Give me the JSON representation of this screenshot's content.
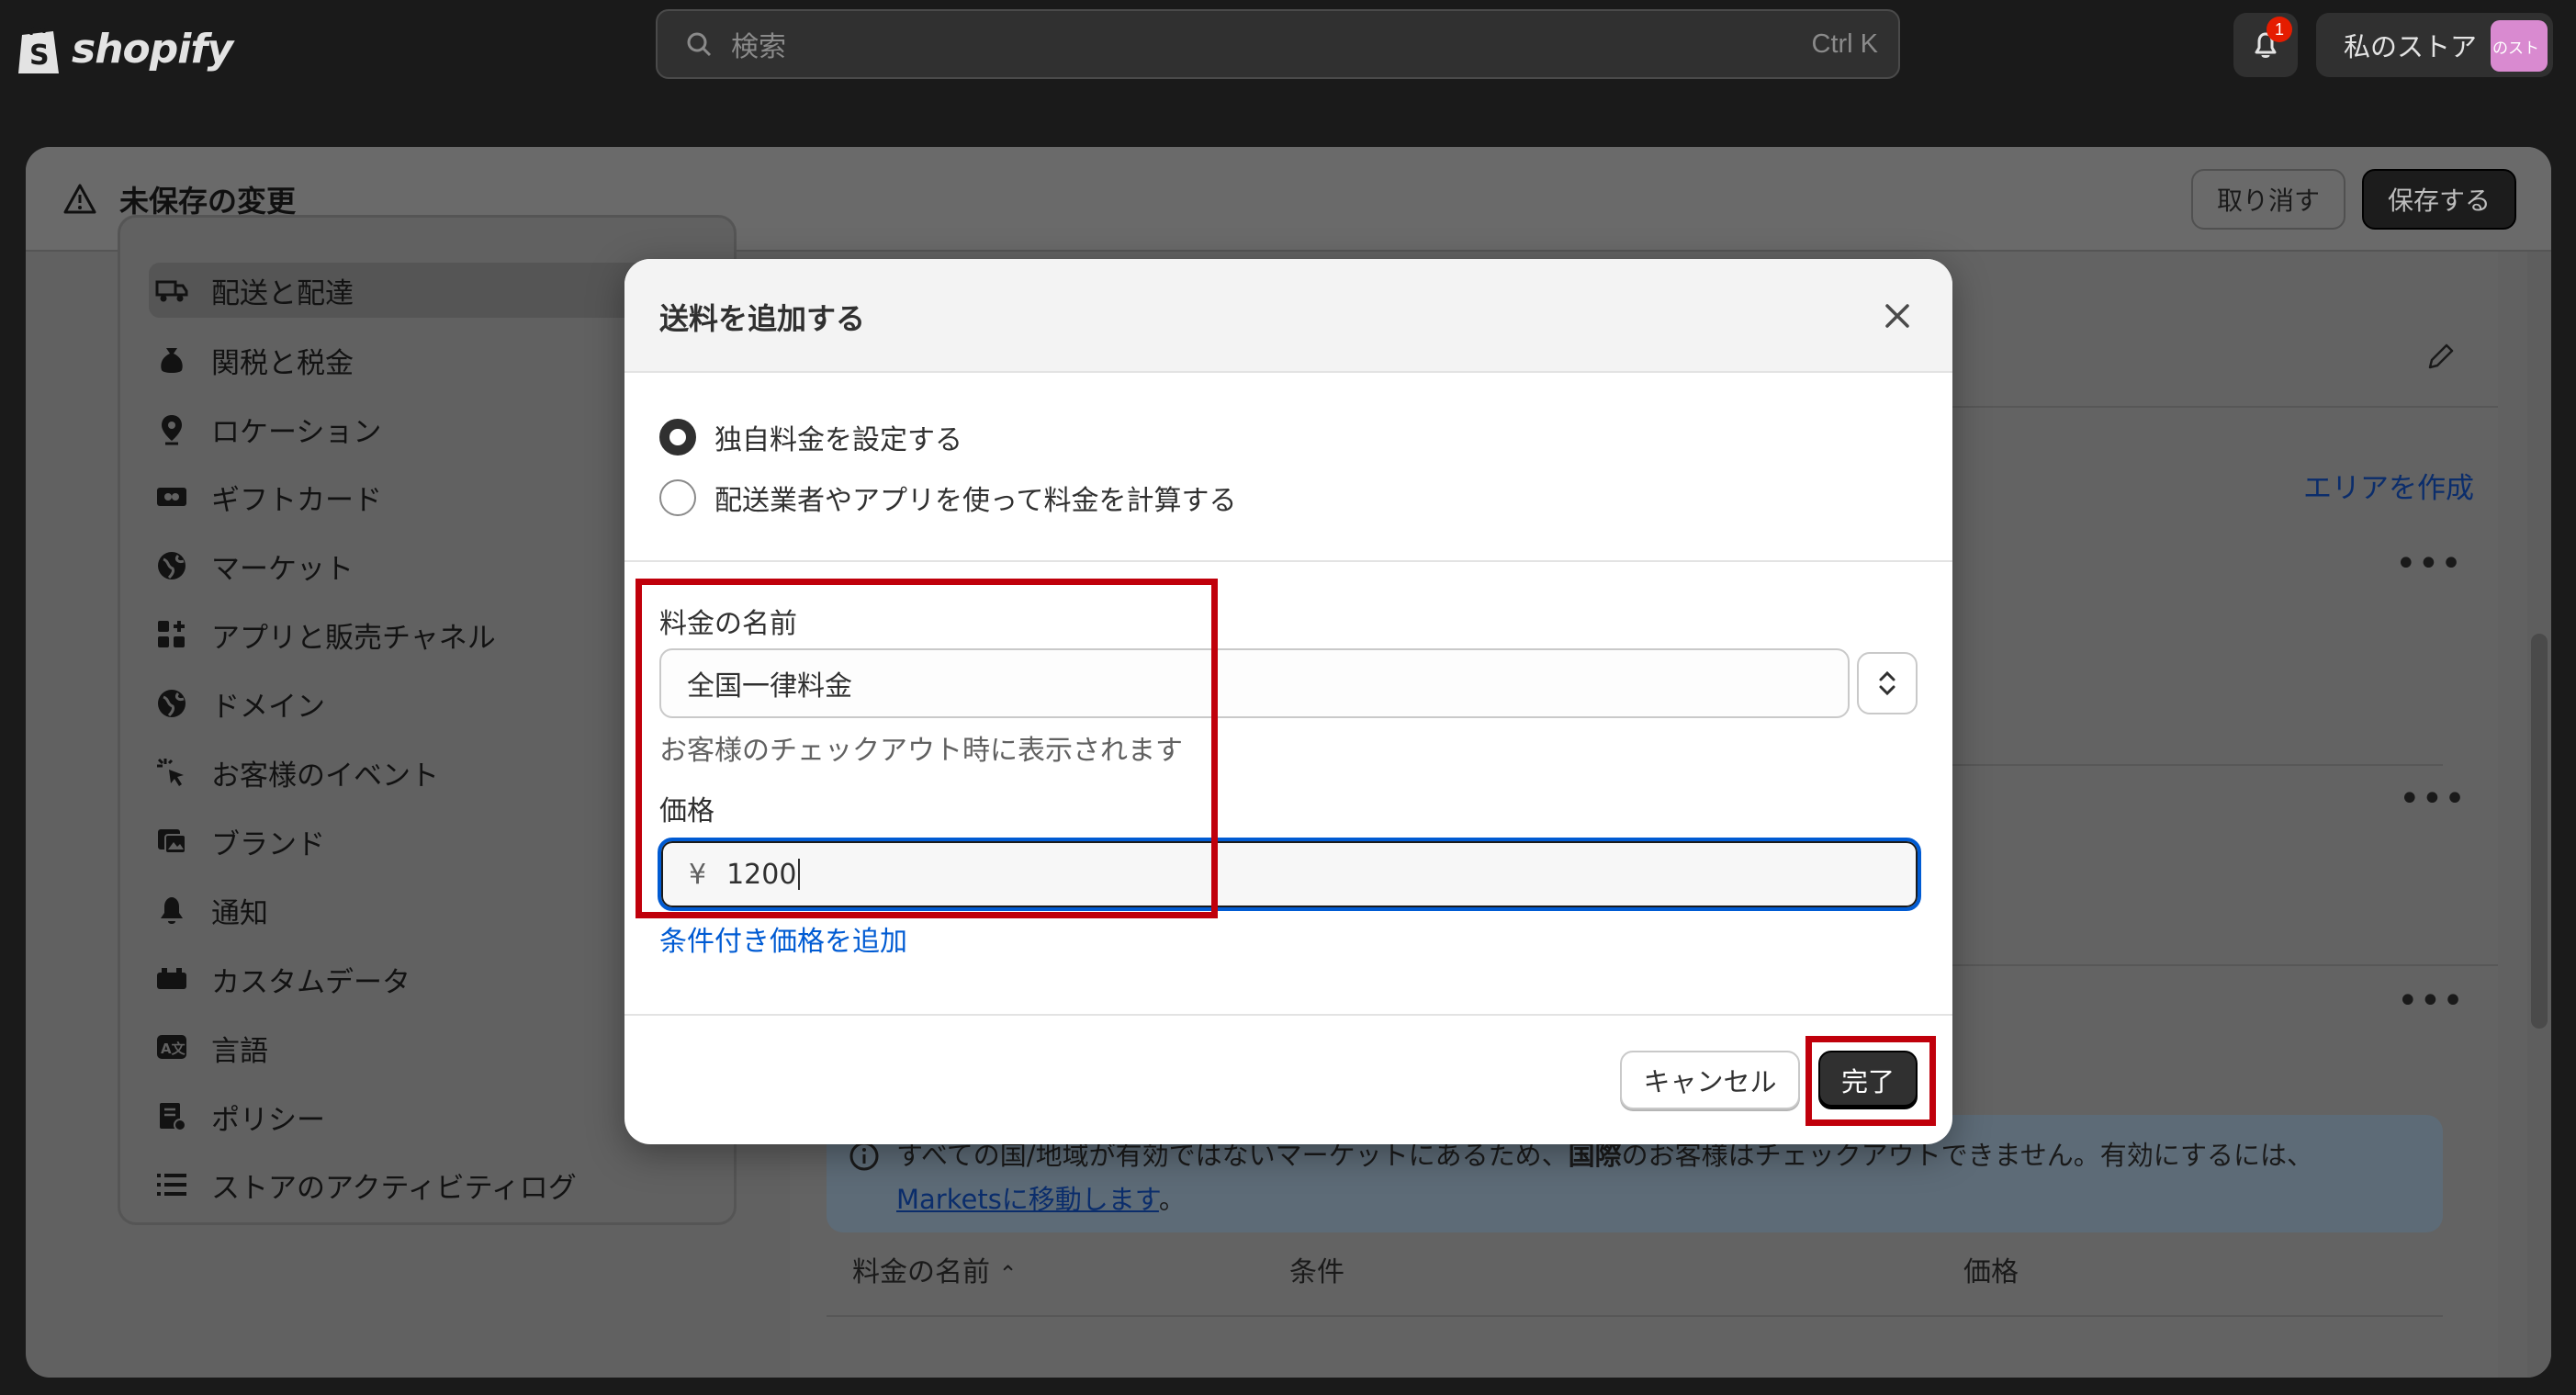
{
  "topbar": {
    "logo_text": "shopify",
    "search_placeholder": "検索",
    "search_shortcut": "Ctrl K",
    "notification_count": "1",
    "store_name": "私のストア",
    "store_avatar": "のスト"
  },
  "unsaved": {
    "title": "未保存の変更",
    "discard_label": "取り消す",
    "save_label": "保存する"
  },
  "sidebar": {
    "items": [
      {
        "label": "配送と配達",
        "icon": "truck-icon"
      },
      {
        "label": "関税と税金",
        "icon": "money-bag-icon"
      },
      {
        "label": "ロケーション",
        "icon": "location-pin-icon"
      },
      {
        "label": "ギフトカード",
        "icon": "gift-card-icon"
      },
      {
        "label": "マーケット",
        "icon": "globe-icon"
      },
      {
        "label": "アプリと販売チャネル",
        "icon": "apps-icon"
      },
      {
        "label": "ドメイン",
        "icon": "domain-globe-icon"
      },
      {
        "label": "お客様のイベント",
        "icon": "cursor-click-icon"
      },
      {
        "label": "ブランド",
        "icon": "brand-image-icon"
      },
      {
        "label": "通知",
        "icon": "bell-icon"
      },
      {
        "label": "カスタムデータ",
        "icon": "database-icon"
      },
      {
        "label": "言語",
        "icon": "translate-icon"
      },
      {
        "label": "ポリシー",
        "icon": "policy-icon"
      },
      {
        "label": "ストアのアクティビティログ",
        "icon": "list-icon"
      }
    ]
  },
  "content": {
    "create_area_link": "エリアを作成",
    "info_text_1": "すべての国/地域が有効ではないマーケットにあるため、",
    "info_strong": "国際",
    "info_text_2": "のお客様はチェックアウトできません。有効にするには、",
    "info_link": "Marketsに移動します",
    "info_text_3": "。",
    "table_headers": [
      "料金の名前",
      "条件",
      "価格"
    ]
  },
  "modal": {
    "title": "送料を追加する",
    "radio_options": [
      {
        "label": "独自料金を設定する",
        "checked": true
      },
      {
        "label": "配送業者やアプリを使って料金を計算する",
        "checked": false
      }
    ],
    "rate_name_label": "料金の名前",
    "rate_name_value": "全国一律料金",
    "rate_name_help": "お客様のチェックアウト時に表示されます",
    "price_label": "価格",
    "price_prefix": "¥",
    "price_value": "1200",
    "add_condition_link": "条件付き価格を追加",
    "cancel_label": "キャンセル",
    "done_label": "完了"
  },
  "colors": {
    "accent": "#005bd3",
    "annotation_red": "#c0000b",
    "primary_button": "#303030"
  }
}
